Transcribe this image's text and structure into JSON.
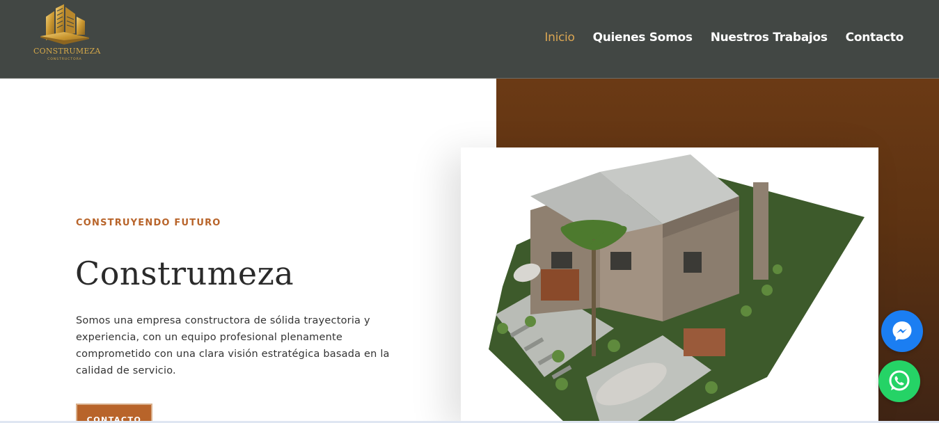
{
  "header": {
    "logo": {
      "name": "CONSTRUMEZA",
      "subtitle": "CONSTRUCTORA",
      "icon": "building-logo-icon",
      "color": "#d6a94a"
    },
    "nav": [
      {
        "label": "Inicio",
        "active": true
      },
      {
        "label": "Quienes Somos",
        "active": false
      },
      {
        "label": "Nuestros Trabajos",
        "active": false
      },
      {
        "label": "Contacto",
        "active": false
      }
    ],
    "background": "#424744",
    "active_color": "#d9a553"
  },
  "hero": {
    "kicker": "CONSTRUYENDO FUTURO",
    "title": "Construmeza",
    "description": "Somos una empresa constructora de sólida trayectoria y experiencia, con un equipo profesional plenamente comprometido con una clara visión estratégica  basada en la calidad de servicio.",
    "cta_label": "CONTACTO",
    "accent": "#b8642a",
    "image": "house-render-image"
  },
  "floating": {
    "messenger_icon": "messenger-icon",
    "whatsapp_icon": "whatsapp-icon",
    "messenger_color": "#1b7ef2",
    "whatsapp_color": "#25d366"
  }
}
